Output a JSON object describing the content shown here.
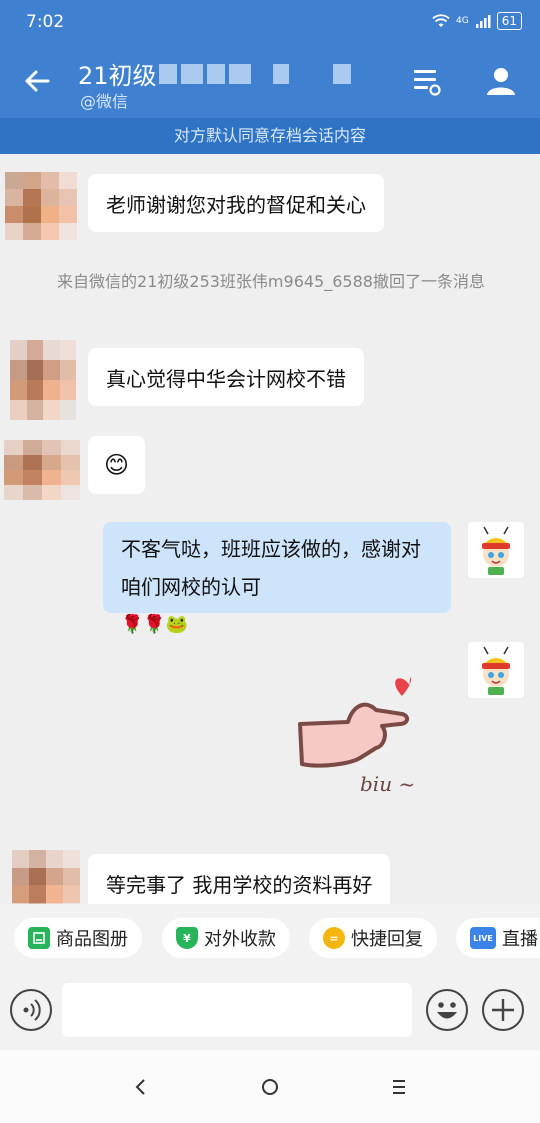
{
  "status": {
    "time": "7:02",
    "network": "4G",
    "battery": "61"
  },
  "header": {
    "title": "21初级",
    "subtitle": "@微信",
    "colors": {
      "bar": "#3f80d0",
      "notice": "#2e73c4"
    }
  },
  "notice": "对方默认同意存档会话内容",
  "messages": [
    {
      "text": "老师谢谢您对我的督促和关心"
    },
    {
      "system": "来自微信的21初级253班张伟m9645_6588撤回了一条消息"
    },
    {
      "text": "真心觉得中华会计网校不错"
    },
    {
      "emoji": "😊"
    },
    {
      "text": "不客气哒，班班应该做的，感谢对咱们网校的认可",
      "emoji": "🌹🌹🐸"
    },
    {
      "sticker_text": "biu ~"
    },
    {
      "text": "等完事了  我用学校的资料再好"
    }
  ],
  "quick": [
    {
      "label": "商品图册",
      "icon": "catalog-icon",
      "color": "#27b45b"
    },
    {
      "label": "对外收款",
      "icon": "payment-icon",
      "color": "#27b45b",
      "glyph": "¥"
    },
    {
      "label": "快捷回复",
      "icon": "quick-reply-icon",
      "color": "#f5b50f",
      "glyph": "="
    },
    {
      "label": "直播",
      "icon": "live-icon",
      "color": "#3a83e8",
      "glyph": "LIVE"
    }
  ],
  "input": {
    "placeholder": ""
  }
}
